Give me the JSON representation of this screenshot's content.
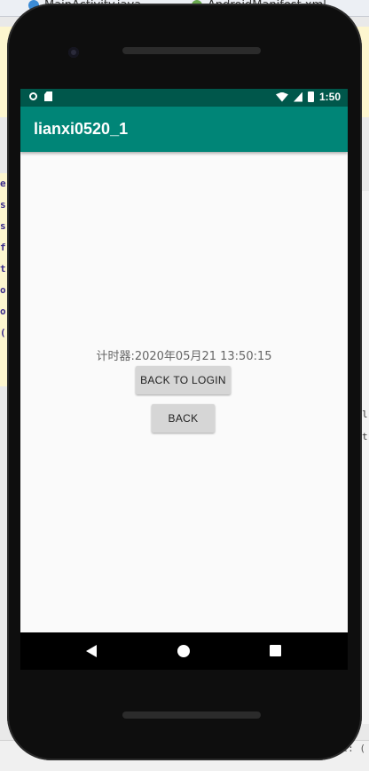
{
  "ide": {
    "tab_1": "MainActivity.java",
    "tab_2": "AndroidManifest.xml",
    "left_code_chars": [
      "e",
      "s",
      "s",
      "f",
      "t",
      "o",
      "o",
      "("
    ],
    "right_code_chars": [
      "l",
      "t"
    ],
    "bottom_text": "ext: ("
  },
  "status_bar": {
    "time": "1:50",
    "background": "#00574b"
  },
  "app_bar": {
    "title": "lianxi0520_1",
    "background": "#008577"
  },
  "content": {
    "timer_text": "计时器:2020年05月21 13:50:15",
    "back_to_login_label": "BACK TO LOGIN",
    "back_label": "BACK"
  },
  "nav_bar": {
    "back_icon": "triangle-back-icon",
    "home_icon": "circle-home-icon",
    "recents_icon": "square-recents-icon"
  }
}
